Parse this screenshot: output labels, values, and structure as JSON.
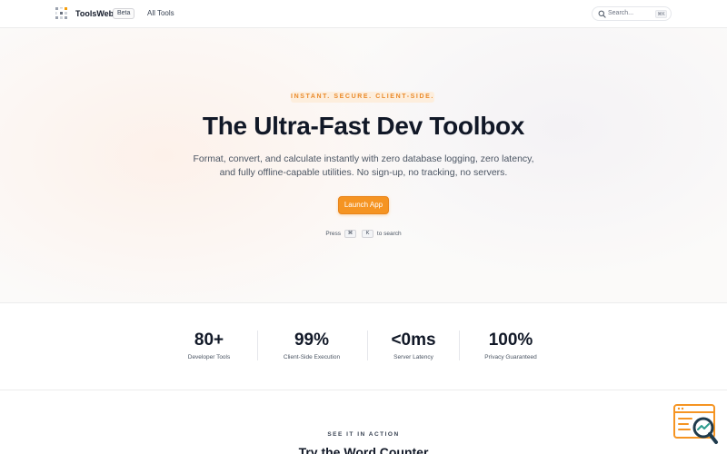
{
  "header": {
    "brand": "ToolsWeb",
    "badge": "Beta",
    "nav_all_tools": "All Tools",
    "search_placeholder": "Search...",
    "search_shortcut": "⌘K"
  },
  "hero": {
    "eyebrow": "INSTANT. SECURE. CLIENT-SIDE.",
    "title": "The Ultra-Fast Dev Toolbox",
    "subtitle_line1": "Format, convert, and calculate instantly with zero database logging, zero latency,",
    "subtitle_line2": "and fully offline-capable utilities. No sign-up, no tracking, no servers.",
    "cta": "Launch App",
    "press_prefix": "Press",
    "key_cmd": "⌘",
    "key_k": "K",
    "press_suffix": "to search"
  },
  "stats": [
    {
      "value": "80+",
      "label": "Developer Tools"
    },
    {
      "value": "99%",
      "label": "Client-Side Execution"
    },
    {
      "value": "<0ms",
      "label": "Server Latency"
    },
    {
      "value": "100%",
      "label": "Privacy Guaranteed"
    }
  ],
  "demo": {
    "eyebrow": "SEE IT IN ACTION",
    "title": "Try the Word Counter"
  },
  "colors": {
    "accent": "#f59422",
    "eyebrow_bg": "#fdeedd",
    "eyebrow_text": "#ea8a2a"
  },
  "icons": {
    "logo": "grid-logo-icon",
    "search": "search-icon",
    "widget": "search-analytics-icon"
  }
}
